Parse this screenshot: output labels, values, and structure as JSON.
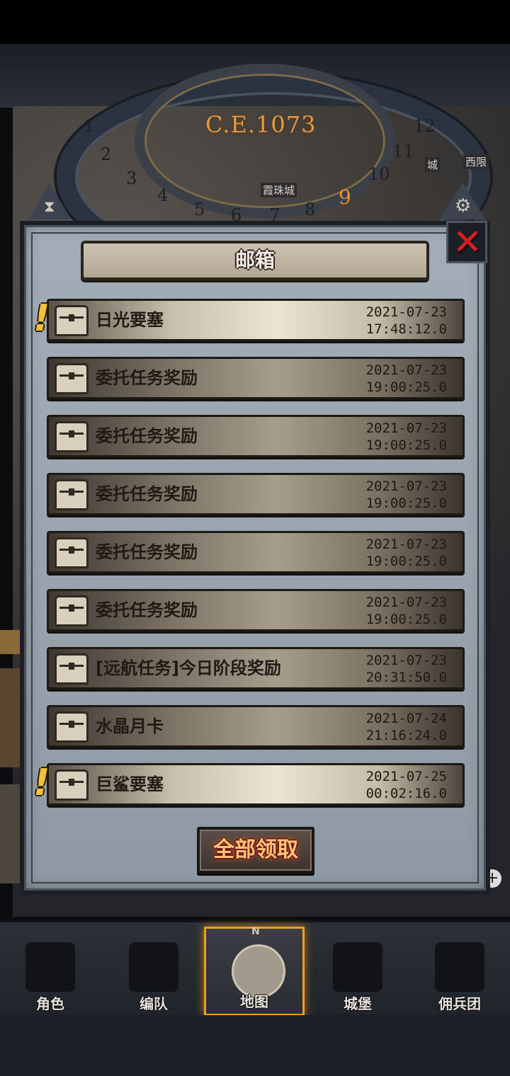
{
  "header": {
    "era": "C.E.1073",
    "selected_month": "9",
    "dial_numbers": [
      "1",
      "2",
      "3",
      "4",
      "5",
      "6",
      "7",
      "8",
      "10",
      "11",
      "12"
    ],
    "map_labels": [
      "霞珠城",
      "城",
      "西限"
    ]
  },
  "mailbox": {
    "title": "邮箱",
    "claim_all_label": "全部领取",
    "items": [
      {
        "title": "日光要塞",
        "date": "2021-07-23",
        "time": "17:48:12.0",
        "unread": true
      },
      {
        "title": "委托任务奖励",
        "date": "2021-07-23",
        "time": "19:00:25.0",
        "unread": false
      },
      {
        "title": "委托任务奖励",
        "date": "2021-07-23",
        "time": "19:00:25.0",
        "unread": false
      },
      {
        "title": "委托任务奖励",
        "date": "2021-07-23",
        "time": "19:00:25.0",
        "unread": false
      },
      {
        "title": "委托任务奖励",
        "date": "2021-07-23",
        "time": "19:00:25.0",
        "unread": false
      },
      {
        "title": "委托任务奖励",
        "date": "2021-07-23",
        "time": "19:00:25.0",
        "unread": false
      },
      {
        "title": "[远航任务]今日阶段奖励",
        "date": "2021-07-23",
        "time": "20:31:50.0",
        "unread": false
      },
      {
        "title": "水晶月卡",
        "date": "2021-07-24",
        "time": "21:16:24.0",
        "unread": false
      },
      {
        "title": "巨鲨要塞",
        "date": "2021-07-25",
        "time": "00:02:16.0",
        "unread": true
      }
    ]
  },
  "nav": {
    "tabs": [
      {
        "label": "角色",
        "icon": "knight-icon",
        "active": false
      },
      {
        "label": "编队",
        "icon": "helmet-icon",
        "active": false
      },
      {
        "label": "地图",
        "icon": "compass-map-icon",
        "active": true
      },
      {
        "label": "城堡",
        "icon": "castle-icon",
        "active": false
      },
      {
        "label": "佣兵团",
        "icon": "banner-icon",
        "active": false
      }
    ],
    "compass_letter": "N"
  },
  "colors": {
    "panel": "#9aa4ae",
    "accent": "#e59f2a",
    "close": "#d62020",
    "alert": "#f3c23a",
    "claim_text": "#ffc27a"
  }
}
